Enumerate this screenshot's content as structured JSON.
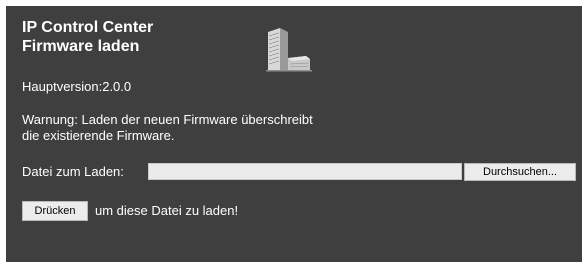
{
  "header": {
    "title_line1": "IP Control Center",
    "title_line2": "Firmware laden",
    "logo_icon": "building-icon"
  },
  "info": {
    "version": "Hauptversion:2.0.0",
    "warning_line1": "Warnung: Laden der neuen Firmware überschreibt",
    "warning_line2": "die existierende Firmware."
  },
  "upload": {
    "file_label": "Datei zum Laden:",
    "file_value": "",
    "browse_label": "Durchsuchen...",
    "submit_label": "Drücken",
    "submit_suffix": "um diese Datei zu laden!"
  },
  "colors": {
    "panel_background": "#3f3f3f",
    "text": "#ffffff",
    "input_background": "#ebebeb",
    "button_background": "#ececec"
  }
}
